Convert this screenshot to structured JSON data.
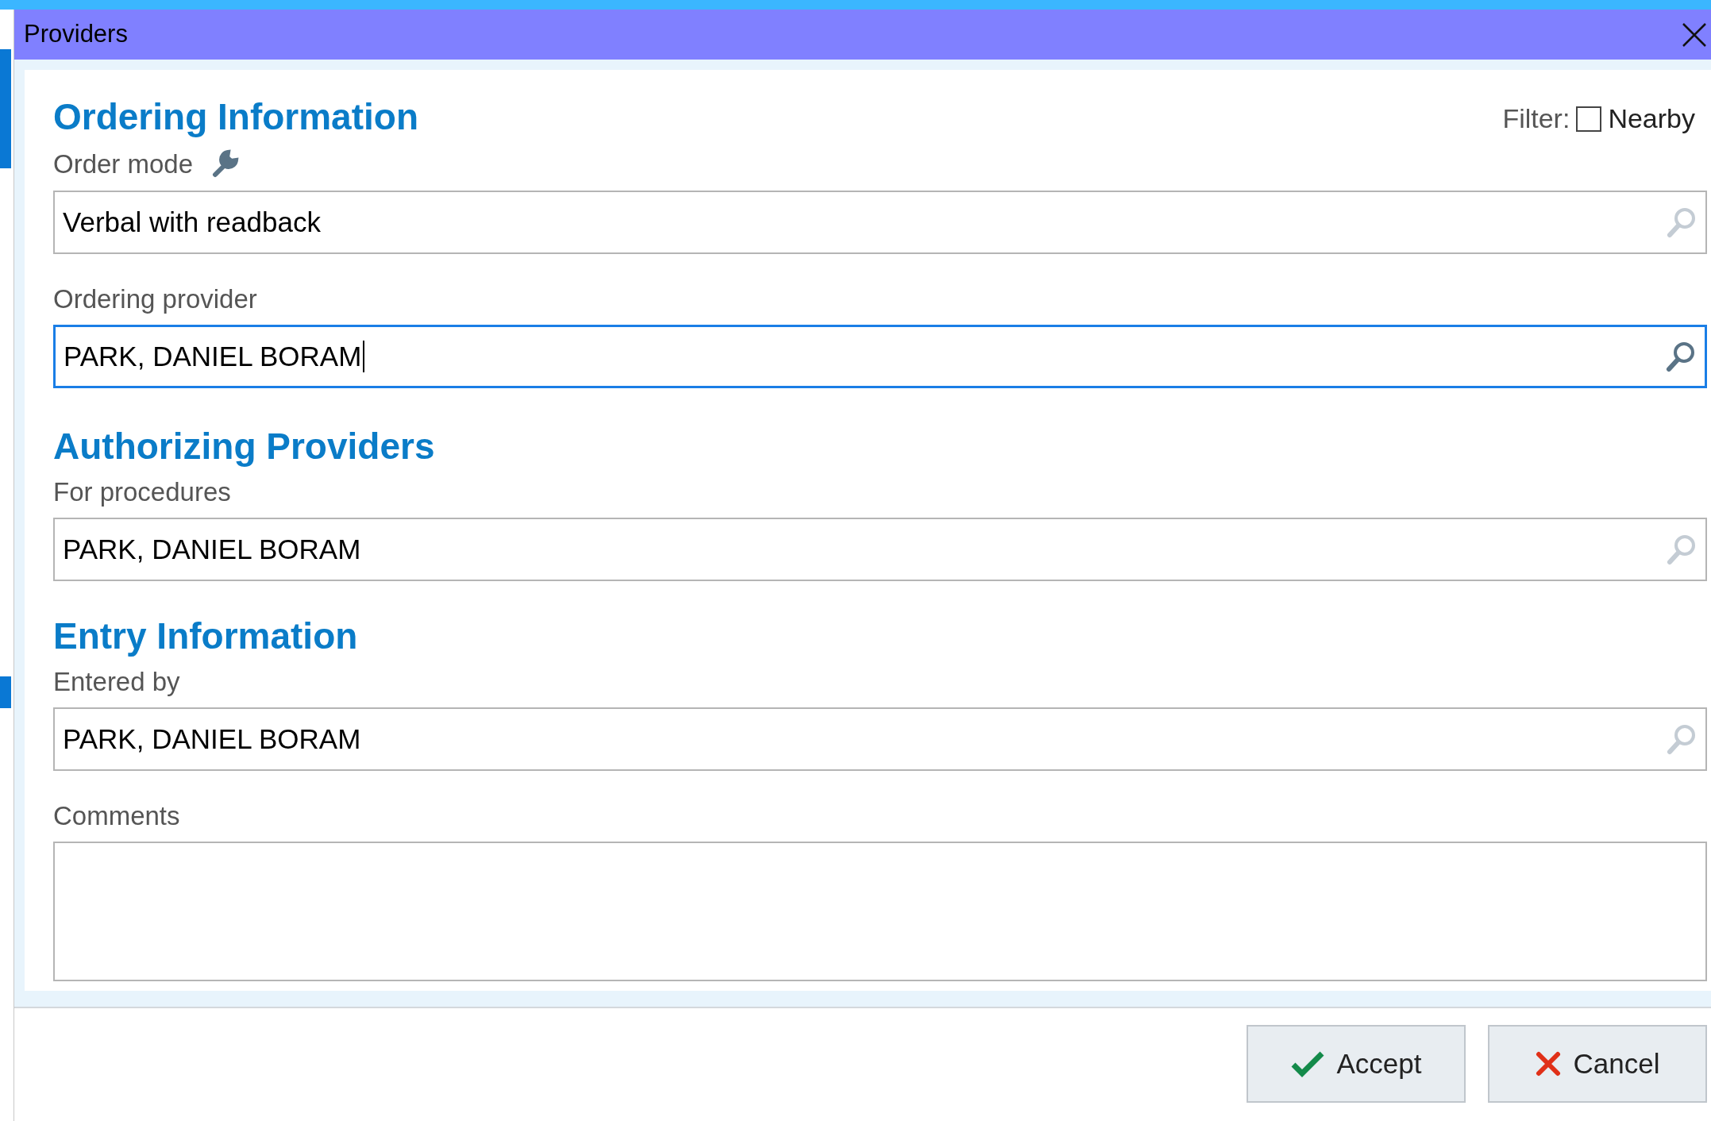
{
  "window": {
    "title": "Providers"
  },
  "filter": {
    "label": "Filter:",
    "option": "Nearby",
    "checked": false
  },
  "sections": [
    {
      "heading": "Ordering Information",
      "fields": [
        {
          "label": "Order mode",
          "label_icon": true,
          "value": "Verbal with readback",
          "focused": false,
          "kind": "lookup"
        },
        {
          "label": "Ordering provider",
          "value": "PARK, DANIEL BORAM",
          "focused": true,
          "kind": "lookup"
        }
      ]
    },
    {
      "heading": "Authorizing Providers",
      "fields": [
        {
          "label": "For procedures",
          "value": "PARK, DANIEL BORAM",
          "focused": false,
          "kind": "lookup"
        }
      ]
    },
    {
      "heading": "Entry Information",
      "fields": [
        {
          "label": "Entered by",
          "value": "PARK, DANIEL BORAM",
          "focused": false,
          "kind": "lookup"
        },
        {
          "label": "Comments",
          "focused": false,
          "kind": "textarea"
        }
      ]
    }
  ],
  "buttons": [
    {
      "label": "Accept",
      "kind": "accept"
    },
    {
      "label": "Cancel",
      "kind": "cancel"
    }
  ]
}
